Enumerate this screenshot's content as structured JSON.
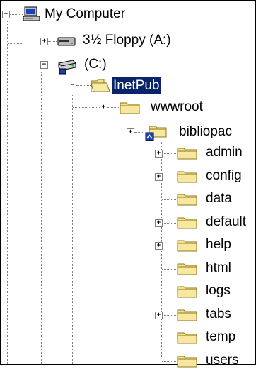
{
  "tree": {
    "root": {
      "label": "My Computer",
      "toggle": "−",
      "icon": "computer-icon"
    },
    "floppy": {
      "label": "3½ Floppy (A:)",
      "toggle": "+",
      "icon": "floppy-drive-icon"
    },
    "cdrive": {
      "label": "(C:)",
      "toggle": "−",
      "icon": "hard-drive-icon"
    },
    "inetpub": {
      "label": "InetPub",
      "toggle": "−",
      "icon": "open-folder-icon",
      "selected": true
    },
    "wwwroot": {
      "label": "wwwroot",
      "toggle": "+",
      "icon": "folder-icon"
    },
    "bibliopac": {
      "label": "bibliopac",
      "toggle": "+",
      "icon": "shared-folder-icon"
    },
    "children": [
      {
        "label": "admin",
        "toggle": "+"
      },
      {
        "label": "config",
        "toggle": "+"
      },
      {
        "label": "data",
        "toggle": ""
      },
      {
        "label": "default",
        "toggle": "+"
      },
      {
        "label": "help",
        "toggle": "+"
      },
      {
        "label": "html",
        "toggle": ""
      },
      {
        "label": "logs",
        "toggle": ""
      },
      {
        "label": "tabs",
        "toggle": "+"
      },
      {
        "label": "temp",
        "toggle": ""
      },
      {
        "label": "users",
        "toggle": ""
      }
    ]
  },
  "colors": {
    "selection": "#0a246a",
    "folder_yellow": "#f6e08a",
    "folder_outline": "#8a7a22"
  }
}
